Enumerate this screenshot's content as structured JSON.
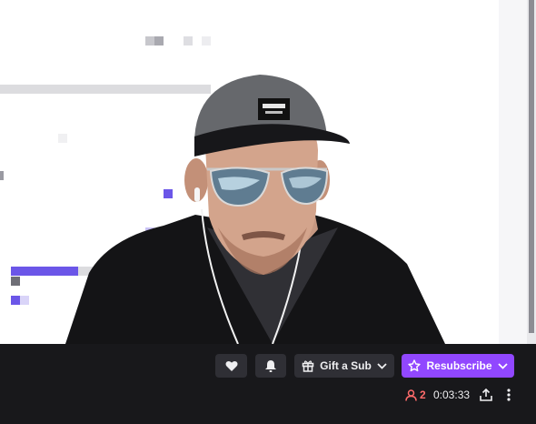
{
  "controls": {
    "gift_label": "Gift a Sub",
    "resubscribe_label": "Resubscribe"
  },
  "status": {
    "viewers": "2",
    "uptime": "0:03:33"
  },
  "colors": {
    "accent": "#9147ff",
    "bar_bg": "#18181b",
    "button_bg": "#2f2f35",
    "viewer_red": "#ff6b6b"
  },
  "icons": [
    "heart-icon",
    "bell-icon",
    "gift-icon",
    "chevron-down-icon",
    "star-icon",
    "viewers-icon",
    "share-icon",
    "more-icon"
  ]
}
